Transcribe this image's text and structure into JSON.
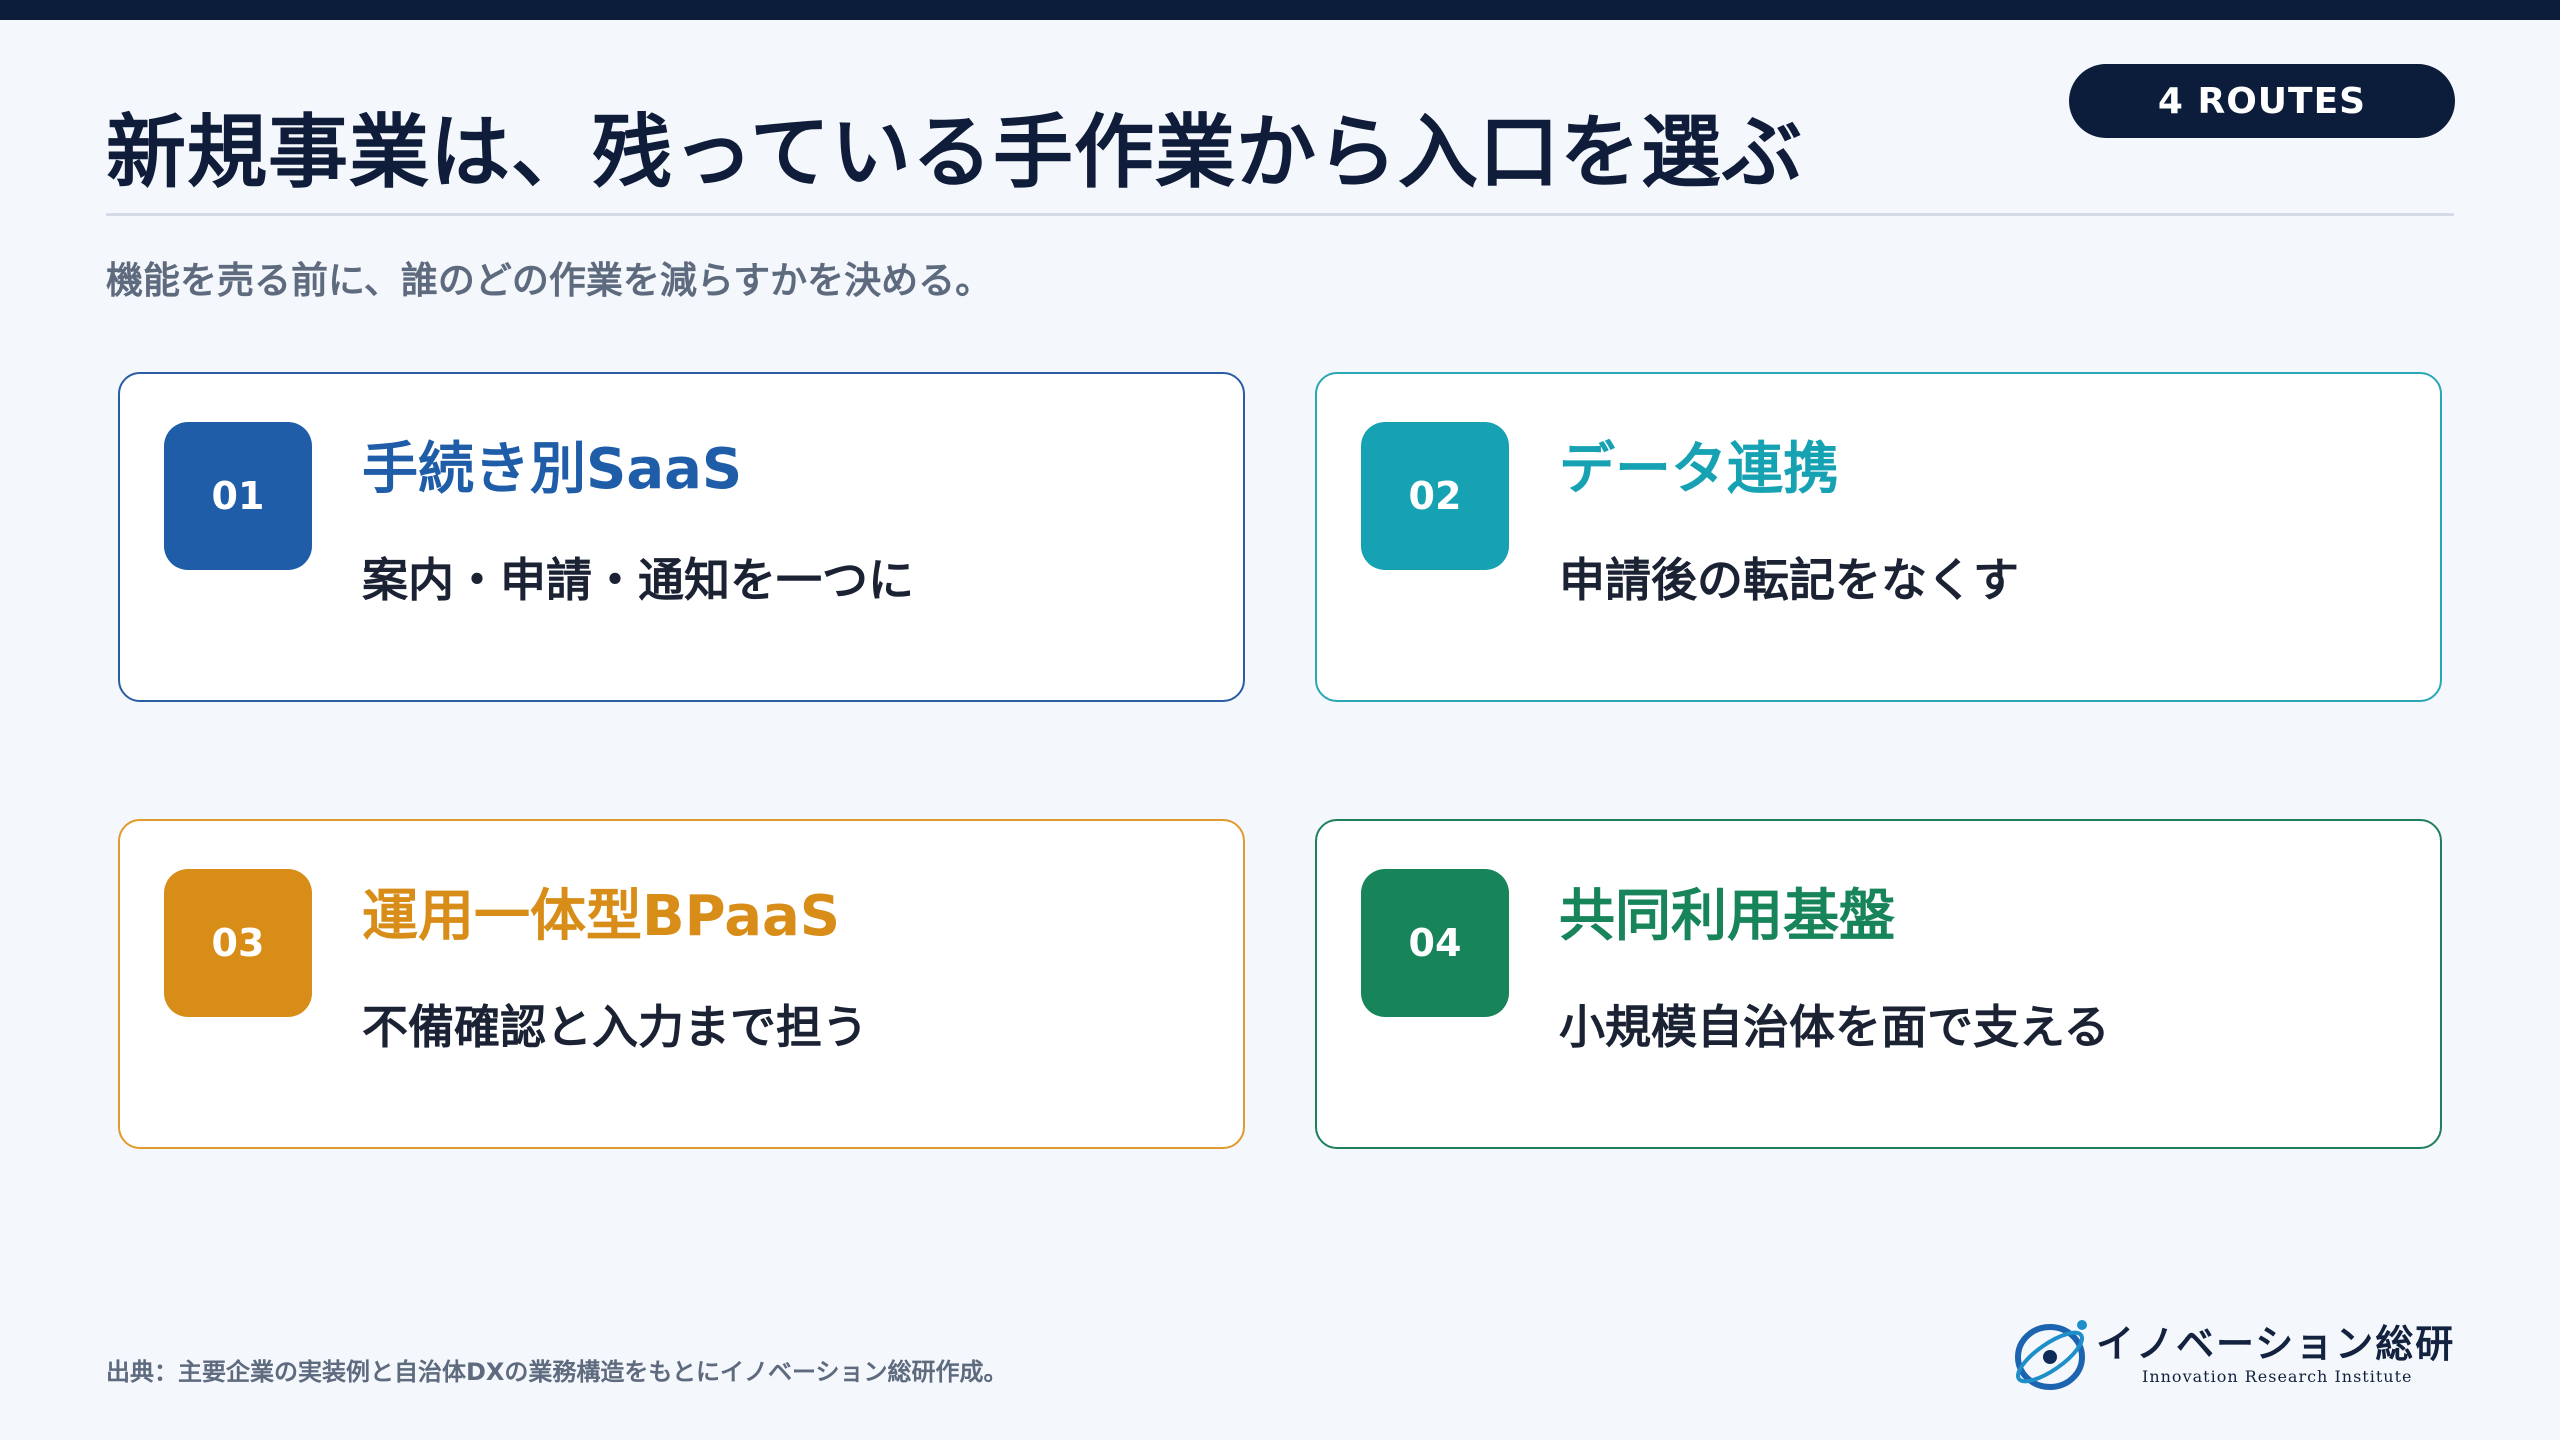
{
  "title": "新規事業は、残っている手作業から入口を選ぶ",
  "badge": "4 ROUTES",
  "subtitle": "機能を売る前に、誰のどの作業を減らすかを決める。",
  "cards": [
    {
      "num": "01",
      "title": "手続き別SaaS",
      "desc": "案内・申請・通知を一つに",
      "color": "#1f5da8",
      "border": "#2a5da3"
    },
    {
      "num": "02",
      "title": "データ連携",
      "desc": "申請後の転記をなくす",
      "color": "#17a2b4",
      "border": "#2aa7b5"
    },
    {
      "num": "03",
      "title": "運用一体型BPaaS",
      "desc": "不備確認と入力まで担う",
      "color": "#d88d18",
      "border": "#e19a2e"
    },
    {
      "num": "04",
      "title": "共同利用基盤",
      "desc": "小規模自治体を面で支える",
      "color": "#17845a",
      "border": "#1f7f5b"
    }
  ],
  "footer": {
    "source": "出典：主要企業の実装例と自治体DXの業務構造をもとにイノベーション総研作成。",
    "logo_name": "イノベーション総研",
    "logo_sub": "Innovation Research Institute"
  }
}
